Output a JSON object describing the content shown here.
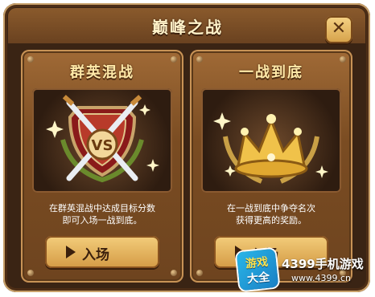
{
  "dialog": {
    "title": "巅峰之战",
    "close_icon": "close-icon",
    "colors": {
      "frame": "#3a2414",
      "title": "#fff2c9",
      "button": "#e6b45e"
    }
  },
  "modes": [
    {
      "title": "群英混战",
      "art_icon": "vs-shield-swords-icon",
      "art_text": "VS",
      "desc_line1": "在群英混战中达成目标分数",
      "desc_line2": "即可入场一战到底。",
      "button_label": "入场",
      "button_icon": "play-icon"
    },
    {
      "title": "一战到底",
      "art_icon": "crown-laurel-icon",
      "desc_line1": "在一战到底中争夺名次",
      "desc_line2": "获得更高的奖励。",
      "button_label": "入场",
      "button_icon": "play-icon"
    }
  ],
  "watermark": {
    "badge_top": "游戏",
    "badge_bottom": "大全",
    "site": "4399手机游戏",
    "url": "www.4399.cn"
  }
}
